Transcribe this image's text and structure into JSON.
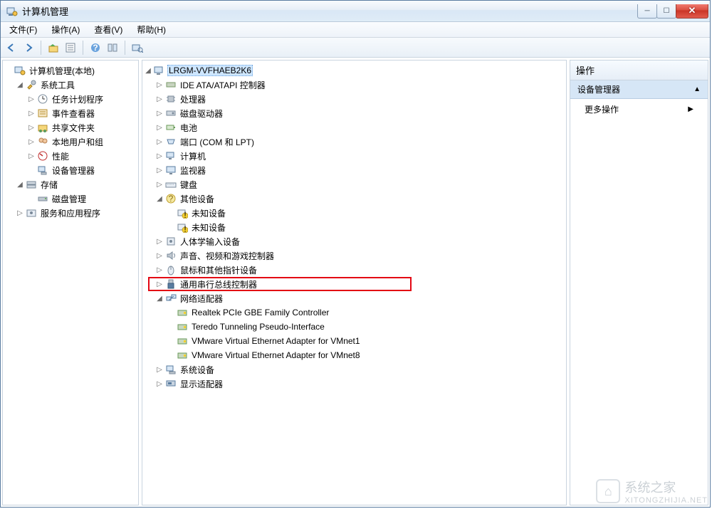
{
  "window": {
    "title": "计算机管理"
  },
  "menu": {
    "file": "文件(F)",
    "action": "操作(A)",
    "view": "查看(V)",
    "help": "帮助(H)"
  },
  "toolbar": {
    "back": "back",
    "forward": "forward",
    "up": "up-folder",
    "prop": "properties",
    "help": "help",
    "list": "list-view",
    "refresh": "refresh"
  },
  "left_tree": {
    "root": "计算机管理(本地)",
    "system_tools": "系统工具",
    "task_scheduler": "任务计划程序",
    "event_viewer": "事件查看器",
    "shared_folders": "共享文件夹",
    "local_users": "本地用户和组",
    "performance": "性能",
    "device_manager": "设备管理器",
    "storage": "存储",
    "disk_management": "磁盘管理",
    "services_apps": "服务和应用程序"
  },
  "center_tree": {
    "root": "LRGM-VVFHAEB2K6",
    "ide": "IDE ATA/ATAPI 控制器",
    "cpu": "处理器",
    "disk_drives": "磁盘驱动器",
    "battery": "电池",
    "ports": "端口 (COM 和 LPT)",
    "computer": "计算机",
    "monitor": "监视器",
    "keyboard": "键盘",
    "other_devices": "其他设备",
    "unknown1": "未知设备",
    "unknown2": "未知设备",
    "hid": "人体学输入设备",
    "sound": "声音、视频和游戏控制器",
    "mouse": "鼠标和其他指针设备",
    "usb": "通用串行总线控制器",
    "network": "网络适配器",
    "net1": "Realtek PCIe GBE Family Controller",
    "net2": "Teredo Tunneling Pseudo-Interface",
    "net3": "VMware Virtual Ethernet Adapter for VMnet1",
    "net4": "VMware Virtual Ethernet Adapter for VMnet8",
    "system_devices": "系统设备",
    "display": "显示适配器"
  },
  "actions": {
    "header": "操作",
    "section": "设备管理器",
    "more": "更多操作"
  },
  "watermark": {
    "brand": "系统之家",
    "url": "XITONGZHIJIA.NET"
  },
  "colors": {
    "highlight": "#e30613",
    "selection": "#cde6ff"
  }
}
